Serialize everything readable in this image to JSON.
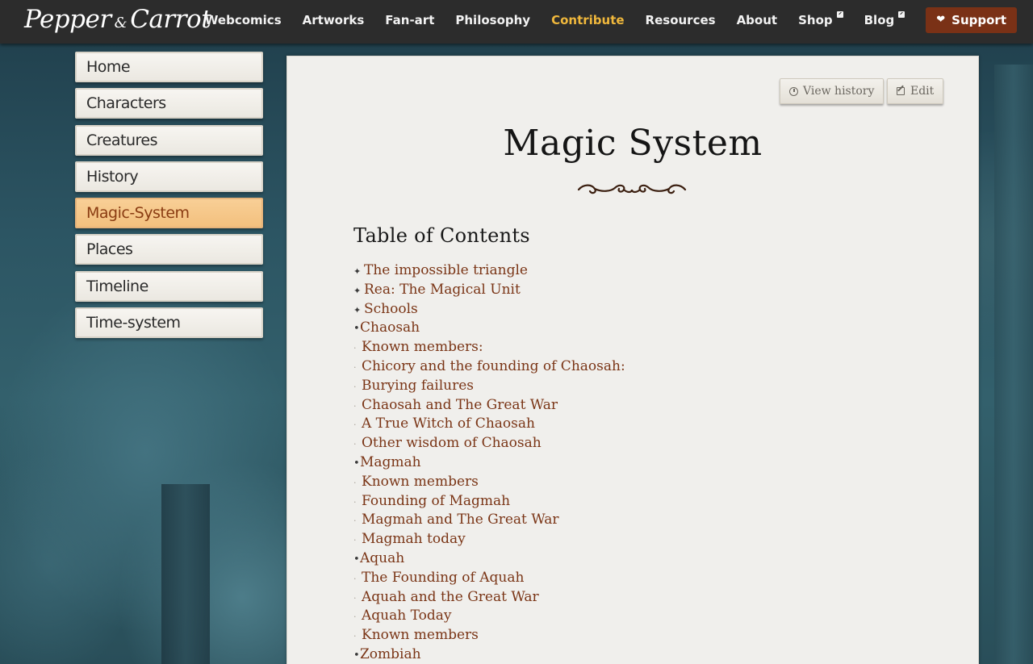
{
  "header": {
    "logo_text_1": "Pepper",
    "logo_amp": "&",
    "logo_text_2": "Carrot",
    "nav": [
      {
        "label": "Webcomics"
      },
      {
        "label": "Artworks"
      },
      {
        "label": "Fan-art"
      },
      {
        "label": "Philosophy"
      },
      {
        "label": "Contribute"
      },
      {
        "label": "Resources"
      },
      {
        "label": "About"
      },
      {
        "label": "Shop"
      },
      {
        "label": "Blog"
      }
    ],
    "support_label": "Support",
    "active_nav": "Contribute",
    "active_color": "#f0b83c"
  },
  "sidebar": {
    "items": [
      {
        "label": "Home"
      },
      {
        "label": "Characters"
      },
      {
        "label": "Creatures"
      },
      {
        "label": "History"
      },
      {
        "label": "Magic-System"
      },
      {
        "label": "Places"
      },
      {
        "label": "Timeline"
      },
      {
        "label": "Time-system"
      }
    ],
    "active": "Magic-System"
  },
  "page": {
    "view_history_label": "View history",
    "edit_label": "Edit",
    "title": "Magic System",
    "toc_heading": "Table of Contents",
    "toc": [
      {
        "marker": "✦",
        "label": "The impossible triangle"
      },
      {
        "marker": "✦",
        "label": "Rea: The Magical Unit"
      },
      {
        "marker": "✦",
        "label": "Schools"
      },
      {
        "marker": "•",
        "label": "Chaosah"
      },
      {
        "marker": "·",
        "label": "Known members:"
      },
      {
        "marker": "·",
        "label": "Chicory and the founding of Chaosah:"
      },
      {
        "marker": "·",
        "label": "Burying failures"
      },
      {
        "marker": "·",
        "label": "Chaosah and The Great War"
      },
      {
        "marker": "·",
        "label": "A True Witch of Chaosah"
      },
      {
        "marker": "·",
        "label": "Other wisdom of Chaosah"
      },
      {
        "marker": "•",
        "label": "Magmah"
      },
      {
        "marker": "·",
        "label": "Known members"
      },
      {
        "marker": "·",
        "label": "Founding of Magmah"
      },
      {
        "marker": "·",
        "label": "Magmah and The Great War"
      },
      {
        "marker": "·",
        "label": "Magmah today"
      },
      {
        "marker": "•",
        "label": "Aquah"
      },
      {
        "marker": "·",
        "label": "The Founding of Aquah"
      },
      {
        "marker": "·",
        "label": "Aquah and the Great War"
      },
      {
        "marker": "·",
        "label": "Aquah Today"
      },
      {
        "marker": "·",
        "label": "Known members"
      },
      {
        "marker": "•",
        "label": "Zombiah"
      }
    ],
    "link_color": "#7a3516"
  }
}
